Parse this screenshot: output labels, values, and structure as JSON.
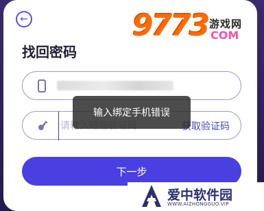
{
  "header": {
    "back_label": "←"
  },
  "title": "找回密码",
  "phone_field": {
    "value_blurred": ""
  },
  "code_field": {
    "placeholder": "请输入短信验证码",
    "get_code_label": "获取验证码"
  },
  "next_button": "下一步",
  "toast": "输入绑定手机错误",
  "watermark_top": {
    "number": "9773",
    "cn": "游戏网",
    "com": "COM"
  },
  "watermark_bottom": {
    "cn": "爱中软件园",
    "en": "WWW.AIZHONGGUO.VIP"
  },
  "colors": {
    "accent": "#4a3fe0",
    "toast_bg": "#2d2d2d",
    "border": "#9e9ab8"
  }
}
